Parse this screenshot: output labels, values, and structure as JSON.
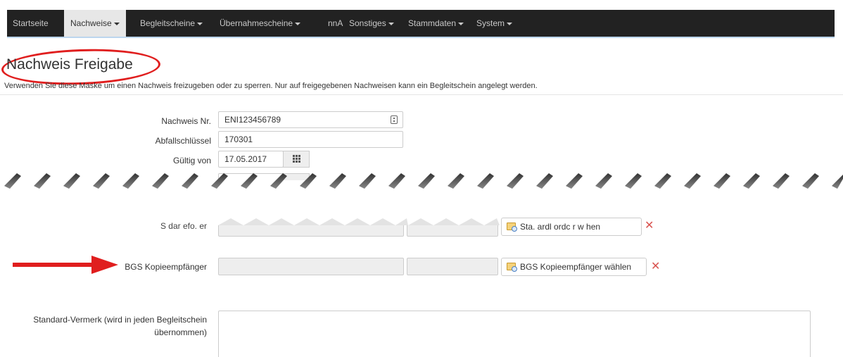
{
  "navbar": {
    "items": [
      {
        "label": "Startseite"
      },
      {
        "label": "Nachweise"
      },
      {
        "label": "Begleitscheine"
      },
      {
        "label": "Übernahmescheine"
      },
      {
        "label": "nnA"
      },
      {
        "label": "Sonstiges"
      },
      {
        "label": "Stammdaten"
      },
      {
        "label": "System"
      }
    ],
    "active_label": "Nachweise"
  },
  "page": {
    "title": "Nachweis Freigabe",
    "subtitle": "Verwenden Sie diese Maske um einen Nachweis freizugeben oder zu sperren. Nur auf freigegebenen Nachweisen kann ein Begleitschein angelegt werden."
  },
  "form": {
    "nachweis_nr": {
      "label": "Nachweis Nr.",
      "value": "ENI123456789"
    },
    "abfallschluessel": {
      "label": "Abfallschlüssel",
      "value": "170301"
    },
    "gueltig_von": {
      "label": "Gültig von",
      "value": "17.05.2017"
    },
    "standardbefoerderer": {
      "label": "S  dar  efo.  er",
      "button_label": "Sta.  ardl  ordc  r w  hen"
    },
    "bgs_kopieempfaenger": {
      "label": "BGS Kopieempfänger",
      "button_label": "BGS Kopieempfänger wählen"
    },
    "standard_vermerk": {
      "label_line1": "Standard-Vermerk (wird in jeden Begleitschein",
      "label_line2": "übernommen)",
      "value": ""
    }
  },
  "colors": {
    "navbar_bg": "#222222",
    "annotation_red": "#e01e1e",
    "remove_icon": "#d9534f"
  }
}
